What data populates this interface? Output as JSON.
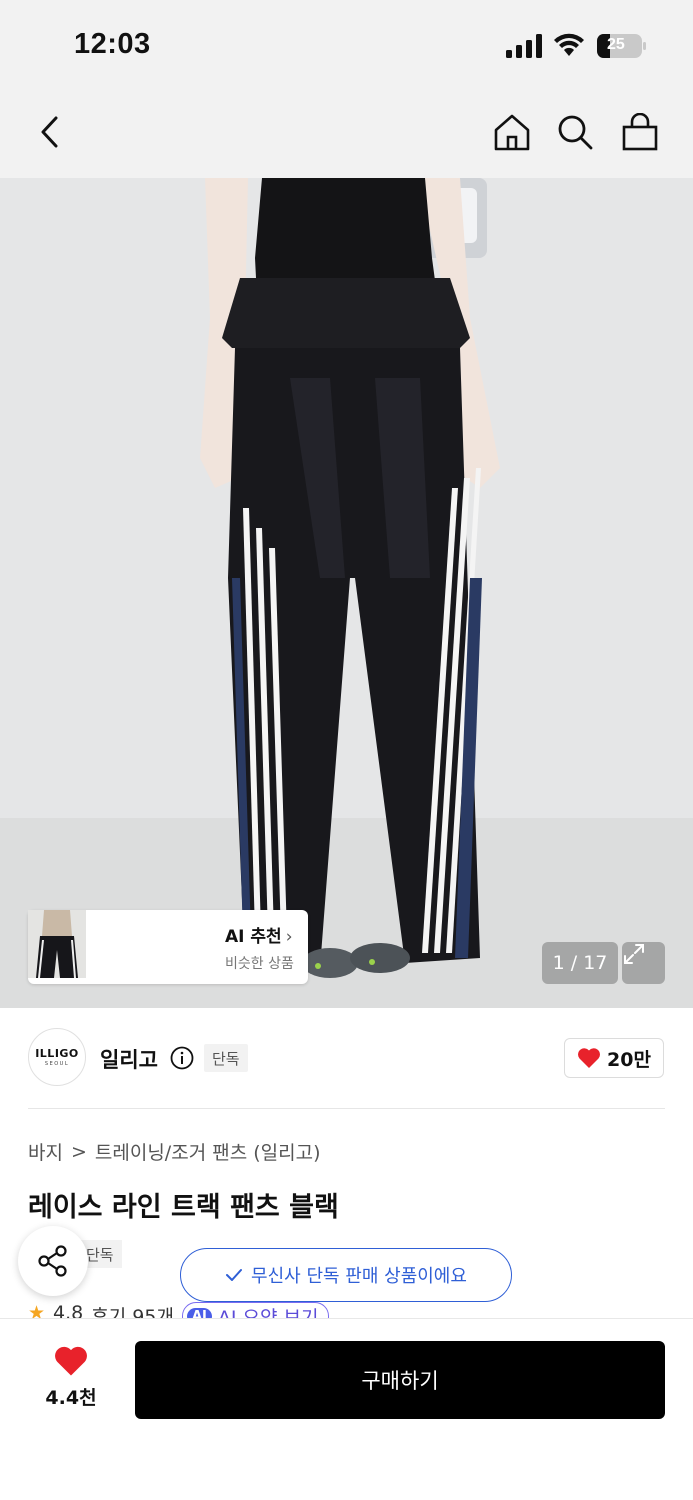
{
  "status_bar": {
    "time": "12:03",
    "battery": "25"
  },
  "nav": {
    "back_icon": "chevron-left-icon",
    "home_icon": "home-icon",
    "search_icon": "search-icon",
    "bag_icon": "shopping-bag-icon"
  },
  "gallery": {
    "ai_card_title": "AI 추천",
    "ai_card_subtitle": "비슷한 상품",
    "counter": "1 / 17"
  },
  "brand": {
    "logo_main": "ILLIGO",
    "logo_sub": "SEOUL",
    "name": "일리고",
    "badge": "단독",
    "likes": "20만"
  },
  "breadcrumb": {
    "category": "바지",
    "separator": ">",
    "subcategory": "트레이닝/조거 팬츠 (일리고)"
  },
  "product": {
    "title": "레이스 라인 트랙 팬츠 블랙",
    "badge": "단독"
  },
  "toast": {
    "message": "무신사 단독 판매 상품이에요"
  },
  "rating": {
    "score": "4.8",
    "reviews": "후기 95개",
    "ai_chip": "AI",
    "ai_summary": "AI 요약 보기"
  },
  "bottom": {
    "like_count": "4.4천",
    "buy_label": "구매하기"
  },
  "colors": {
    "accent_blue": "#2f5fd6",
    "heart_red": "#e8222b",
    "buy_bg": "#000000"
  }
}
